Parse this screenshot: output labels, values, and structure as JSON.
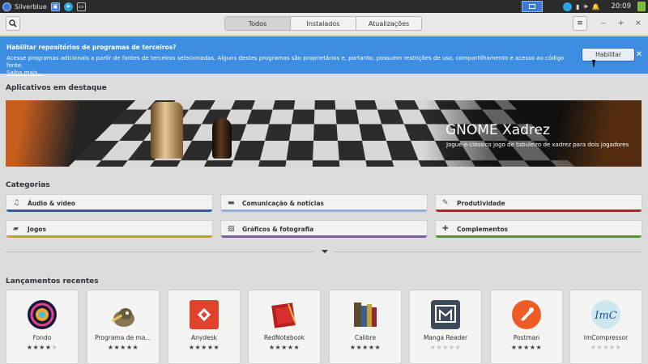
{
  "system_panel": {
    "title": "Silverblue",
    "clock": "20:09"
  },
  "header": {
    "tabs": [
      {
        "label": "Todos",
        "active": true
      },
      {
        "label": "Instalados",
        "active": false
      },
      {
        "label": "Atualizações",
        "active": false
      }
    ]
  },
  "infobar": {
    "heading": "Habilitar repositórios de programas de terceiros?",
    "description": "Acesse programas adicionais a partir de fontes de terceiros selecionadas. Alguns destes programas são proprietários e, portanto, possuem restrições de uso, compartilhamento e acesso ao código fonte.",
    "link": "Saiba mais…",
    "button": "Habilitar",
    "color": "#3d8ee3"
  },
  "featured": {
    "section_title": "Aplicativos em destaque",
    "app_title": "GNOME Xadrez",
    "app_subtitle": "Jogue o clássico jogo de tabuleiro de xadrez para dois jogadores"
  },
  "categories": {
    "section_title": "Categorias",
    "items": [
      {
        "label": "Áudio & vídeo",
        "icon": "music-note-icon",
        "color": "#2a5ea8"
      },
      {
        "label": "Comunicação & notícias",
        "icon": "chat-icon",
        "color": "#8fb3d9"
      },
      {
        "label": "Produtividade",
        "icon": "edit-icon",
        "color": "#c01c28"
      },
      {
        "label": "Jogos",
        "icon": "gamepad-icon",
        "color": "#c9a400"
      },
      {
        "label": "Gráficos & fotografia",
        "icon": "image-icon",
        "color": "#7c5c9c"
      },
      {
        "label": "Complementos",
        "icon": "puzzle-icon",
        "color": "#4c9a2a"
      }
    ]
  },
  "recent": {
    "section_title": "Lançamentos recentes",
    "apps": [
      {
        "name": "Fondo",
        "rating": 4
      },
      {
        "name": "Programa de ma…",
        "rating": 5
      },
      {
        "name": "Anydesk",
        "rating": 5
      },
      {
        "name": "RedNotebook",
        "rating": 5
      },
      {
        "name": "Calibre",
        "rating": 5
      },
      {
        "name": "Manga Reader",
        "rating": 0
      },
      {
        "name": "Postman",
        "rating": 5
      },
      {
        "name": "ImCompressor",
        "rating": 0
      }
    ]
  }
}
